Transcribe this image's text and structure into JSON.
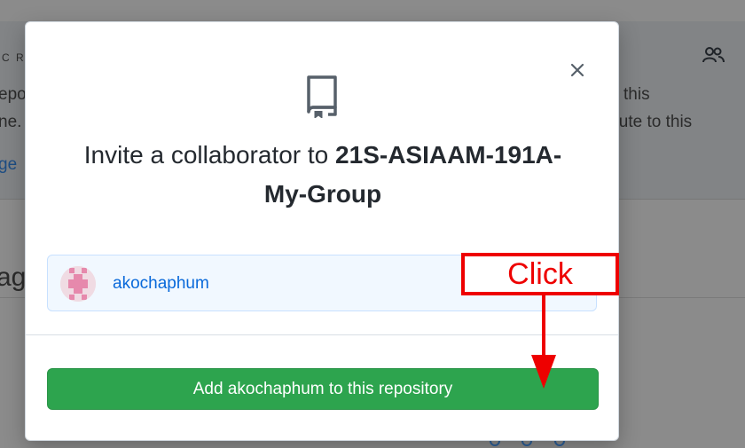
{
  "background": {
    "fragments": {
      "col_letter_1": "C",
      "col_letter_2": "R",
      "left_line_1": "epo",
      "left_line_2": "ne.",
      "left_link": "ge",
      "right_line_1": "this",
      "right_line_2": "ibute to this",
      "heading_fragment": "ag"
    },
    "icons": [
      "people-icon"
    ]
  },
  "modal": {
    "close_icon": "close-icon",
    "repo_icon": "repo-icon",
    "title_prefix": "Invite a collaborator to ",
    "title_repo": "21S-ASIAAM-191A-My-Group",
    "selected_user": {
      "username": "akochaphum",
      "avatar": "identicon-avatar"
    },
    "add_button_label": "Add akochaphum to this repository"
  },
  "annotation": {
    "label": "Click",
    "color": "#ee0000"
  },
  "colors": {
    "primary_button": "#2da44e",
    "link": "#0969da",
    "card_background": "#f1f8ff"
  }
}
